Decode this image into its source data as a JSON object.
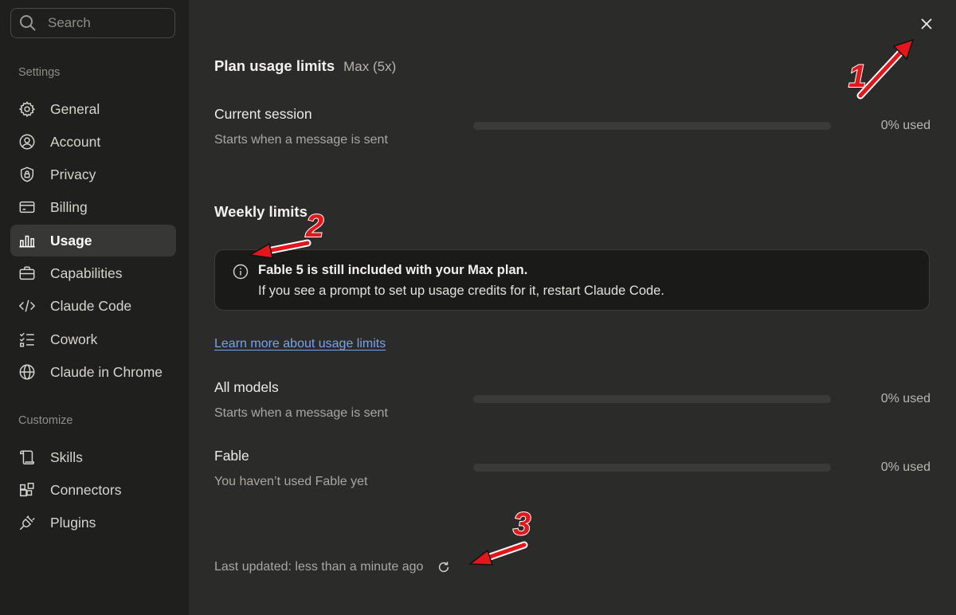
{
  "sidebar": {
    "search_placeholder": "Search",
    "settings_label": "Settings",
    "customize_label": "Customize",
    "items": [
      {
        "label": "General",
        "icon": "gear-icon"
      },
      {
        "label": "Account",
        "icon": "user-circle-icon"
      },
      {
        "label": "Privacy",
        "icon": "lock-shield-icon"
      },
      {
        "label": "Billing",
        "icon": "credit-card-icon"
      },
      {
        "label": "Usage",
        "icon": "bar-chart-icon",
        "active": true
      },
      {
        "label": "Capabilities",
        "icon": "briefcase-icon"
      },
      {
        "label": "Claude Code",
        "icon": "code-icon"
      },
      {
        "label": "Cowork",
        "icon": "checklist-icon"
      },
      {
        "label": "Claude in Chrome",
        "icon": "globe-icon"
      }
    ],
    "customize_items": [
      {
        "label": "Skills",
        "icon": "scroll-icon"
      },
      {
        "label": "Connectors",
        "icon": "blocks-icon"
      },
      {
        "label": "Plugins",
        "icon": "plug-icon"
      }
    ]
  },
  "main": {
    "title": "Plan usage limits",
    "plan": "Max (5x)",
    "current_session": {
      "title": "Current session",
      "subtitle": "Starts when a message is sent",
      "percent_text": "0% used",
      "percent": 0
    },
    "weekly_title": "Weekly limits",
    "notice": {
      "line1": "Fable 5 is still included with your Max plan.",
      "line2": "If you see a prompt to set up usage credits for it, restart Claude Code."
    },
    "learn_more": "Learn more about usage limits",
    "all_models": {
      "title": "All models",
      "subtitle": "Starts when a message is sent",
      "percent_text": "0% used",
      "percent": 0
    },
    "fable": {
      "title": "Fable",
      "subtitle": "You haven’t used Fable yet",
      "percent_text": "0% used",
      "percent": 0
    },
    "last_updated": "Last updated: less than a minute ago"
  },
  "annotations": {
    "one": "1",
    "two": "2",
    "three": "3",
    "color": "#e4161c"
  }
}
